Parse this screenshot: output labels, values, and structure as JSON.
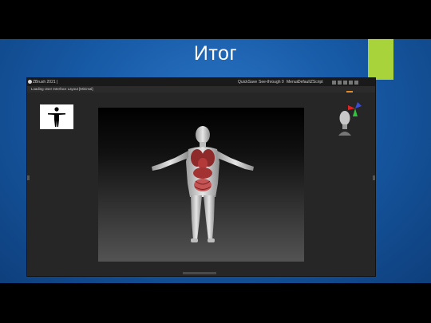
{
  "slide": {
    "title": "Итог",
    "background_color": "#175aa6",
    "accent_color": "#a8d33a"
  },
  "app": {
    "title": "ZBrush 2021 |",
    "subtitle": "Loading User Interface Layout [Minimal]",
    "quicksave_label": "QuickSave",
    "see_through_label": "See-through",
    "see_through_value": "0",
    "menus_label": "Menus",
    "script_label": "DefaultZScript"
  },
  "icons": [
    "zbrush-logo-icon",
    "human-figure-icon",
    "head-model-icon",
    "axis-gizmo-icon"
  ]
}
